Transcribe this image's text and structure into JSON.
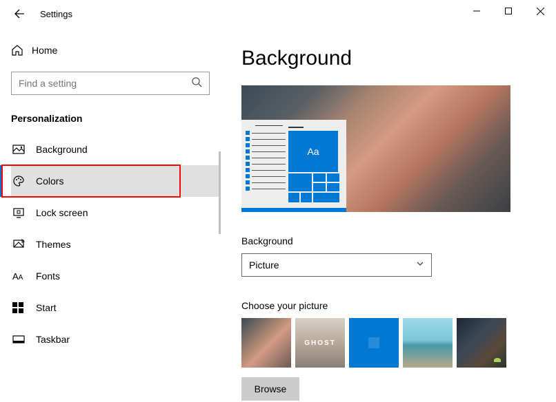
{
  "window": {
    "title": "Settings"
  },
  "sidebar": {
    "home": "Home",
    "search_placeholder": "Find a setting",
    "category": "Personalization",
    "items": [
      {
        "label": "Background"
      },
      {
        "label": "Colors"
      },
      {
        "label": "Lock screen"
      },
      {
        "label": "Themes"
      },
      {
        "label": "Fonts"
      },
      {
        "label": "Start"
      },
      {
        "label": "Taskbar"
      }
    ]
  },
  "main": {
    "title": "Background",
    "preview_sample_text": "Aa",
    "background_label": "Background",
    "background_value": "Picture",
    "choose_picture_label": "Choose your picture",
    "thumb_ghost_text": "GHOST",
    "browse_label": "Browse"
  }
}
